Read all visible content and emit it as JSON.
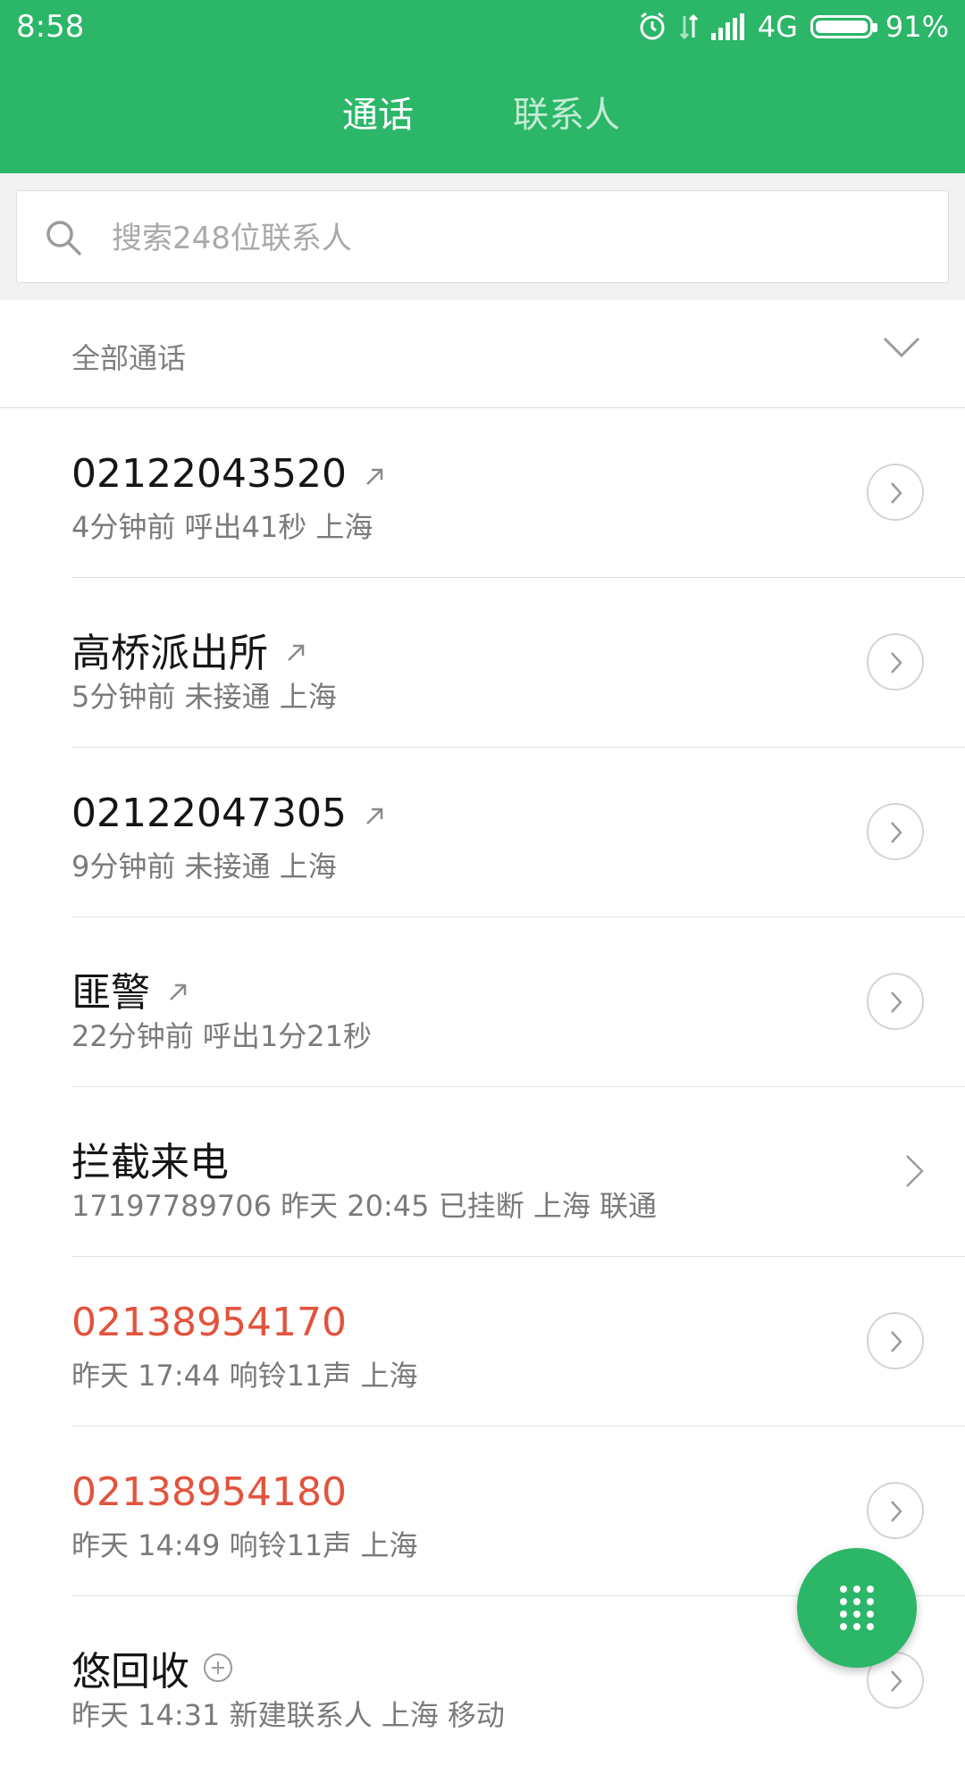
{
  "status_bar": {
    "time": "8:58",
    "network": "4G",
    "battery_percent": "91%",
    "battery_level": 0.91,
    "icons": [
      "alarm-icon",
      "data-arrows-icon",
      "signal-icon",
      "battery-icon"
    ]
  },
  "tabs": [
    {
      "label": "通话",
      "active": true
    },
    {
      "label": "联系人",
      "active": false
    }
  ],
  "search": {
    "placeholder": "搜索248位联系人",
    "value": ""
  },
  "filter": {
    "label": "全部通话"
  },
  "calls": [
    {
      "title": "02122043520",
      "sub": "4分钟前 呼出41秒  上海",
      "type": "outgoing",
      "missed": false
    },
    {
      "title": "高桥派出所",
      "sub": "5分钟前 未接通  上海",
      "type": "outgoing",
      "missed": false
    },
    {
      "title": "02122047305",
      "sub": "9分钟前 未接通  上海",
      "type": "outgoing",
      "missed": false
    },
    {
      "title": "匪警",
      "sub": "22分钟前 呼出1分21秒",
      "type": "outgoing",
      "missed": false
    },
    {
      "title": "拦截来电",
      "sub": "17197789706  昨天 20:45 已挂断  上海 联通",
      "type": "blocked",
      "missed": false
    },
    {
      "title": "02138954170",
      "sub": "昨天 17:44 响铃11声  上海",
      "type": "missed",
      "missed": true
    },
    {
      "title": "02138954180",
      "sub": "昨天 14:49 响铃11声  上海",
      "type": "missed",
      "missed": true
    },
    {
      "title": "悠回收",
      "sub": "昨天 14:31 新建联系人  上海 移动",
      "type": "new-contact",
      "missed": false
    }
  ],
  "colors": {
    "brand_green": "#2bb668",
    "missed_red": "#e2533d"
  },
  "fab": {
    "icon": "dialpad-icon"
  }
}
